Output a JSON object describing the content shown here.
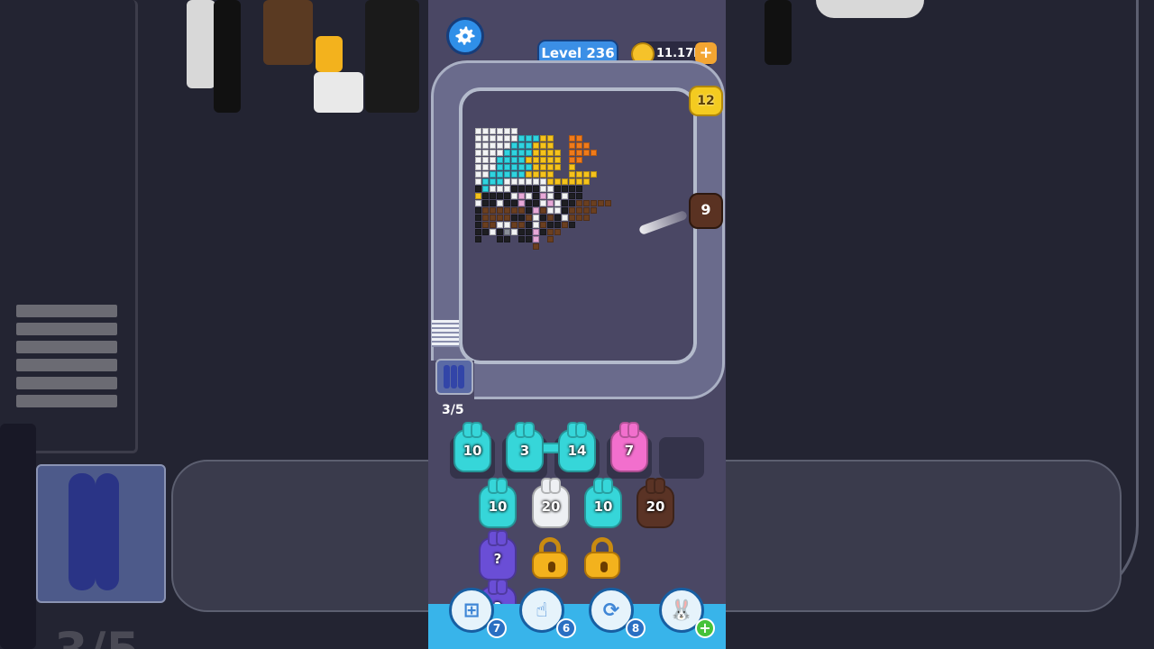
{
  "hud": {
    "level": "Level 236",
    "coins": "11.17k",
    "coin_add": "+"
  },
  "board": {
    "shooter_yellow": "12",
    "shooter_brown": "9",
    "queue_counter": "3/5"
  },
  "queue": {
    "row1": [
      "10",
      "3",
      "14",
      "7"
    ],
    "row2": [
      "10",
      "20",
      "10",
      "20"
    ],
    "row3": [
      "?"
    ],
    "row4": [
      "?"
    ]
  },
  "boosters": {
    "add_slot_count": "7",
    "hand_count": "6",
    "shuffle_count": "8",
    "get_more": "+"
  },
  "colors": {
    "cyan": "#36d6d9",
    "pink": "#f26fcd",
    "white": "#eef0f3",
    "brown": "#5a3325",
    "yellow": "#f4cb20",
    "mystery": "#6a4ed6",
    "track_blue": "#38b4ea"
  },
  "backdrop": {
    "counter": "3/5"
  }
}
